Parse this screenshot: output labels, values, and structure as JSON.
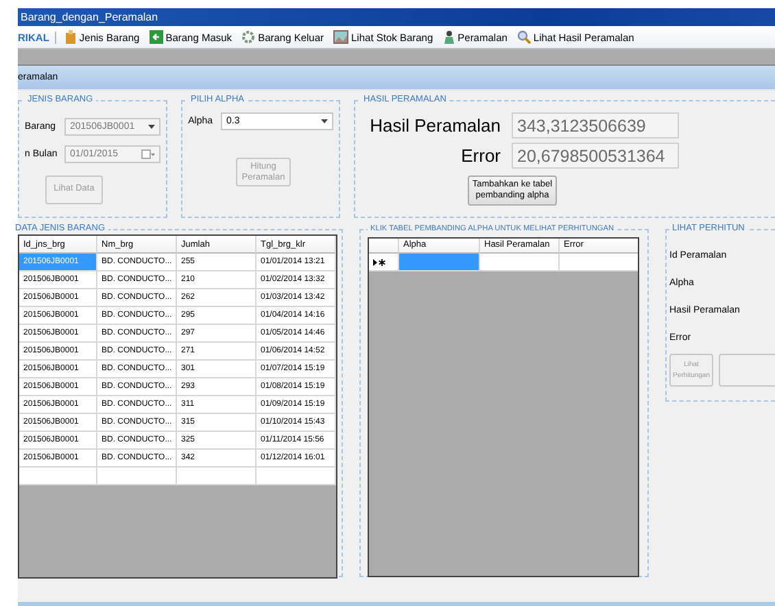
{
  "window": {
    "title": "Barang_dengan_Peramalan"
  },
  "menu": [
    {
      "label": "RIKAL",
      "kind": "text"
    },
    {
      "label": "Jenis Barang",
      "kind": "box"
    },
    {
      "label": "Barang Masuk",
      "kind": "arrow"
    },
    {
      "label": "Barang Keluar",
      "kind": "gear"
    },
    {
      "label": "Lihat Stok Barang",
      "kind": "picture"
    },
    {
      "label": "Peramalan",
      "kind": "figure"
    },
    {
      "label": "Lihat Hasil Peramalan",
      "kind": "search"
    }
  ],
  "tab": {
    "title": "eramalan"
  },
  "jenis_barang": {
    "title": "JENIS BARANG",
    "fields": [
      {
        "label": "Barang",
        "value": "201506JB0001",
        "kind": "combo"
      },
      {
        "label": "n Bulan",
        "value": "01/01/2015",
        "kind": "date"
      }
    ],
    "button": {
      "label": "Lihat Data",
      "disabled": true
    }
  },
  "pilih_alpha": {
    "title": "PILIH ALPHA",
    "label": "Alpha",
    "value": "0.3",
    "button": {
      "label": "Hitung Peramalan",
      "disabled": true
    }
  },
  "hasil_peramalan": {
    "title": "HASIL PERAMALAN",
    "fields": [
      {
        "label": "Hasil Peramalan",
        "value": "343,3123506639"
      },
      {
        "label": "Error",
        "value": "20,6798500531364"
      }
    ],
    "button": {
      "label": "Tambahkan ke tabel pembanding alpha",
      "disabled": false
    }
  },
  "data_jenis_barang": {
    "title": "DATA JENIS BARANG",
    "columns": [
      "Id_jns_brg",
      "Nm_brg",
      "Jumlah",
      "Tgl_brg_klr"
    ],
    "rows": [
      {
        "cells": [
          "201506JB0001",
          "BD. CONDUCTO...",
          "255",
          "01/01/2014 13:21"
        ],
        "selected": true
      },
      {
        "cells": [
          "201506JB0001",
          "BD. CONDUCTO...",
          "210",
          "01/02/2014 13:32"
        ],
        "selected": false
      },
      {
        "cells": [
          "201506JB0001",
          "BD. CONDUCTO...",
          "262",
          "01/03/2014 13:42"
        ],
        "selected": false
      },
      {
        "cells": [
          "201506JB0001",
          "BD. CONDUCTO...",
          "295",
          "01/04/2014 14:16"
        ],
        "selected": false
      },
      {
        "cells": [
          "201506JB0001",
          "BD. CONDUCTO...",
          "297",
          "01/05/2014 14:46"
        ],
        "selected": false
      },
      {
        "cells": [
          "201506JB0001",
          "BD. CONDUCTO...",
          "271",
          "01/06/2014 14:52"
        ],
        "selected": false
      },
      {
        "cells": [
          "201506JB0001",
          "BD. CONDUCTO...",
          "301",
          "01/07/2014 15:19"
        ],
        "selected": false
      },
      {
        "cells": [
          "201506JB0001",
          "BD. CONDUCTO...",
          "293",
          "01/08/2014 15:19"
        ],
        "selected": false
      },
      {
        "cells": [
          "201506JB0001",
          "BD. CONDUCTO...",
          "311",
          "01/09/2014 15:19"
        ],
        "selected": false
      },
      {
        "cells": [
          "201506JB0001",
          "BD. CONDUCTO...",
          "315",
          "01/10/2014 15:43"
        ],
        "selected": false
      },
      {
        "cells": [
          "201506JB0001",
          "BD. CONDUCTO...",
          "325",
          "01/11/2014 15:56"
        ],
        "selected": false
      },
      {
        "cells": [
          "201506JB0001",
          "BD. CONDUCTO...",
          "342",
          "01/12/2014 16:01"
        ],
        "selected": false
      }
    ]
  },
  "pembanding": {
    "title": "KLIK TABEL PEMBANDING ALPHA UNTUK MELIHAT PERHITUNGAN",
    "columns": [
      "Alpha",
      "Hasil Peramalan",
      "Error"
    ],
    "new_row": {
      "selected": true
    }
  },
  "lihat_perhitungan": {
    "title": "LIHAT PERHITUN",
    "labels": [
      "Id Peramalan",
      "Alpha",
      "Hasil Peramalan",
      "Error"
    ],
    "button": {
      "label": "Lihat Perhitungan",
      "disabled": true
    }
  }
}
